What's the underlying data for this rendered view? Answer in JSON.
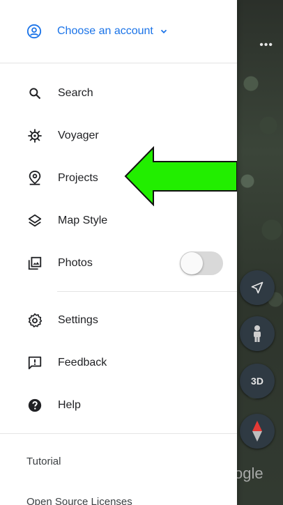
{
  "header": {
    "account_label": "Choose an account"
  },
  "menu": [
    {
      "key": "search",
      "label": "Search",
      "icon": "search-icon"
    },
    {
      "key": "voyager",
      "label": "Voyager",
      "icon": "voyager-wheel-icon"
    },
    {
      "key": "projects",
      "label": "Projects",
      "icon": "projects-pin-icon"
    },
    {
      "key": "map_style",
      "label": "Map Style",
      "icon": "layers-icon"
    },
    {
      "key": "photos",
      "label": "Photos",
      "icon": "photos-icon",
      "toggle_on": false
    }
  ],
  "menu2": [
    {
      "key": "settings",
      "label": "Settings",
      "icon": "gear-icon"
    },
    {
      "key": "feedback",
      "label": "Feedback",
      "icon": "feedback-icon"
    },
    {
      "key": "help",
      "label": "Help",
      "icon": "help-icon"
    }
  ],
  "footer": {
    "tutorial": "Tutorial",
    "licenses": "Open Source Licenses"
  },
  "map": {
    "three_d": "3D",
    "watermark": "ogle"
  },
  "colors": {
    "accent": "#1a73e8",
    "arrow_fill": "#22ee00",
    "map_button": "#2f3a43"
  }
}
